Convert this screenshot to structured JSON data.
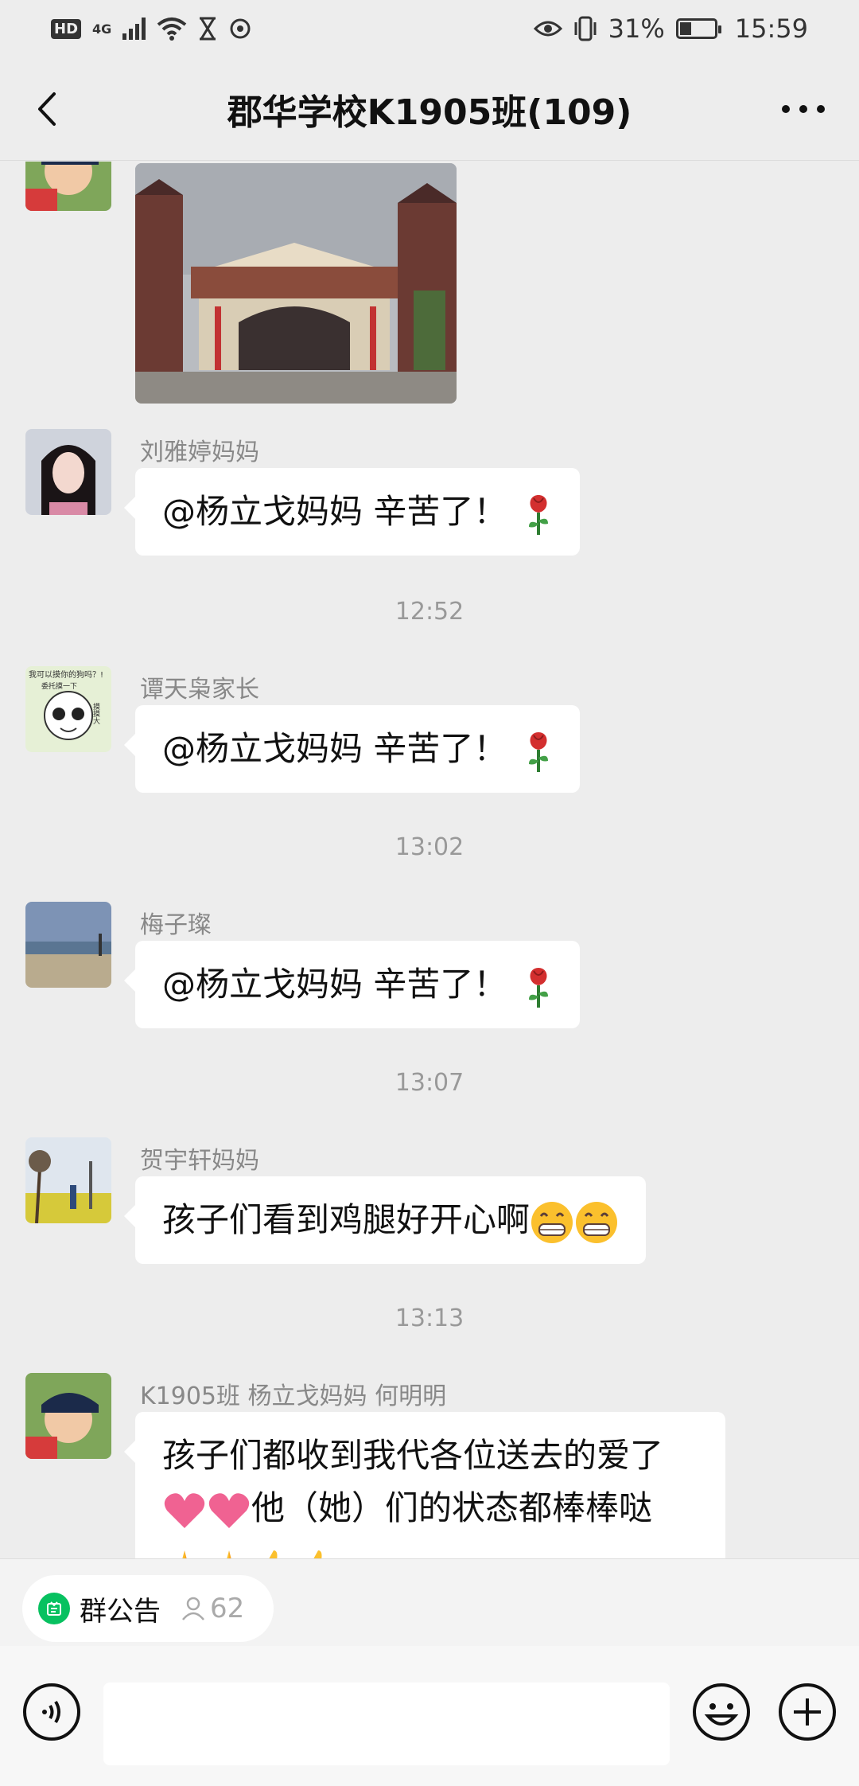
{
  "status_bar": {
    "hd": "HD",
    "network": "4G",
    "battery_percent": "31%",
    "time": "15:59"
  },
  "header": {
    "title": "郡华学校K1905班(109)"
  },
  "messages": [
    {
      "sender": "刘雅婷妈妈",
      "text": "@杨立戈妈妈  辛苦了！"
    },
    {
      "time": "12:52"
    },
    {
      "sender": "谭天枭家长",
      "text": "@杨立戈妈妈  辛苦了！"
    },
    {
      "time": "13:02"
    },
    {
      "sender": "梅子璨",
      "text": "@杨立戈妈妈  辛苦了！"
    },
    {
      "time": "13:07"
    },
    {
      "sender": "贺宇轩妈妈",
      "text": "孩子们看到鸡腿好开心啊"
    },
    {
      "time": "13:13"
    },
    {
      "sender": "K1905班 杨立戈妈妈 何明明",
      "text_line1": "孩子们都收到我代各位送去的爱了",
      "text_line2": "他（她）们的状态都棒棒哒"
    }
  ],
  "avatar_doodle_text": [
    "我可以摸你的狗吗？!",
    "委托摸一下",
    "摸摸大"
  ],
  "notice": {
    "label": "群公告",
    "count": "62"
  },
  "colors": {
    "background": "#ededed",
    "bubble": "#ffffff",
    "accent_green": "#07c160"
  }
}
